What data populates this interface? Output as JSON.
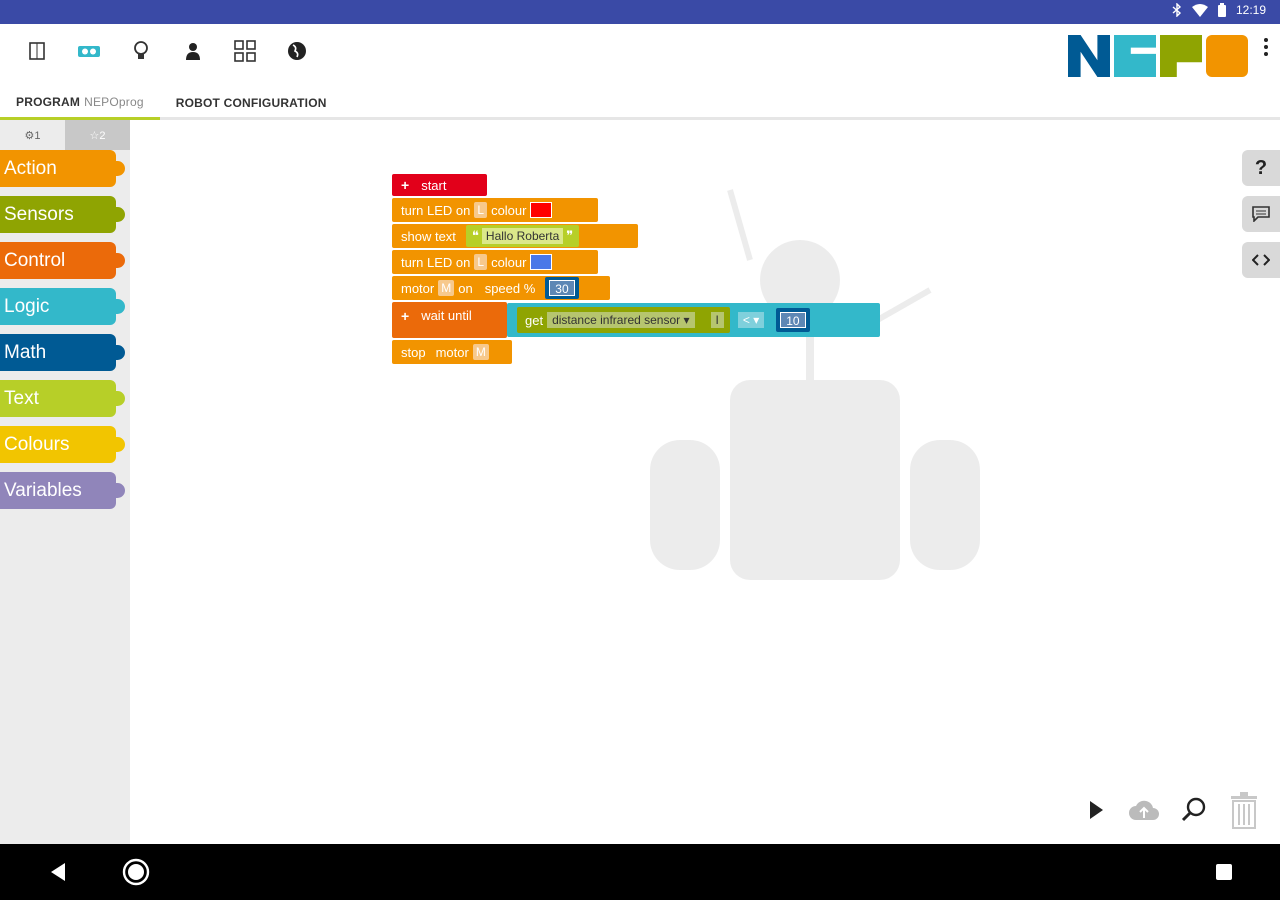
{
  "status_bar": {
    "time": "12:19",
    "icons": [
      "bluetooth-icon",
      "wifi-icon",
      "battery-icon"
    ]
  },
  "toolbar": {
    "icons": [
      "program-icon",
      "robot-icon",
      "bulb-icon",
      "user-icon",
      "gallery-icon",
      "globe-icon"
    ]
  },
  "tabs": [
    {
      "label": "PROGRAM",
      "sub": "NEPOprog"
    },
    {
      "label": "ROBOT CONFIGURATION"
    }
  ],
  "logo": {
    "colors": [
      "#005a94",
      "#33b8ca",
      "#8fa402",
      "#f29400"
    ]
  },
  "sidebar": {
    "level_tabs": [
      "⚙1",
      "☆2"
    ],
    "categories": [
      {
        "label": "Action",
        "color": "#f29400"
      },
      {
        "label": "Sensors",
        "color": "#8fa402"
      },
      {
        "label": "Control",
        "color": "#eb6a0a"
      },
      {
        "label": "Logic",
        "color": "#33b8ca"
      },
      {
        "label": "Math",
        "color": "#005a94"
      },
      {
        "label": "Text",
        "color": "#b7cf28"
      },
      {
        "label": "Colours",
        "color": "#f2c500"
      },
      {
        "label": "Variables",
        "color": "#9085ba"
      }
    ]
  },
  "program": {
    "start": "start",
    "led1": {
      "text": "turn LED on",
      "port": "L",
      "colour_label": "colour",
      "colour": "#ff0000"
    },
    "show_text": {
      "text": "show text",
      "open_quote": "❝",
      "value": "Hallo Roberta",
      "close_quote": "❞"
    },
    "led2": {
      "text": "turn LED on",
      "port": "L",
      "colour_label": "colour",
      "colour": "#4a78e8"
    },
    "motor": {
      "text": "motor",
      "port": "M",
      "on": "on",
      "speed": "speed %",
      "value": "30"
    },
    "wait": {
      "text": "wait until",
      "get": "get",
      "sensor": "distance  infrared sensor ▾",
      "port": "I",
      "op": "< ▾",
      "value": "10"
    },
    "stop": {
      "text": "stop",
      "motor": "motor",
      "port": "M"
    }
  },
  "side_tools": [
    "help-icon",
    "comment-icon",
    "code-icon"
  ],
  "bottom_tools": [
    "run-icon",
    "upload-icon",
    "zoom-icon",
    "trash-icon"
  ],
  "nav": [
    "back-icon",
    "home-icon",
    "recents-icon"
  ]
}
